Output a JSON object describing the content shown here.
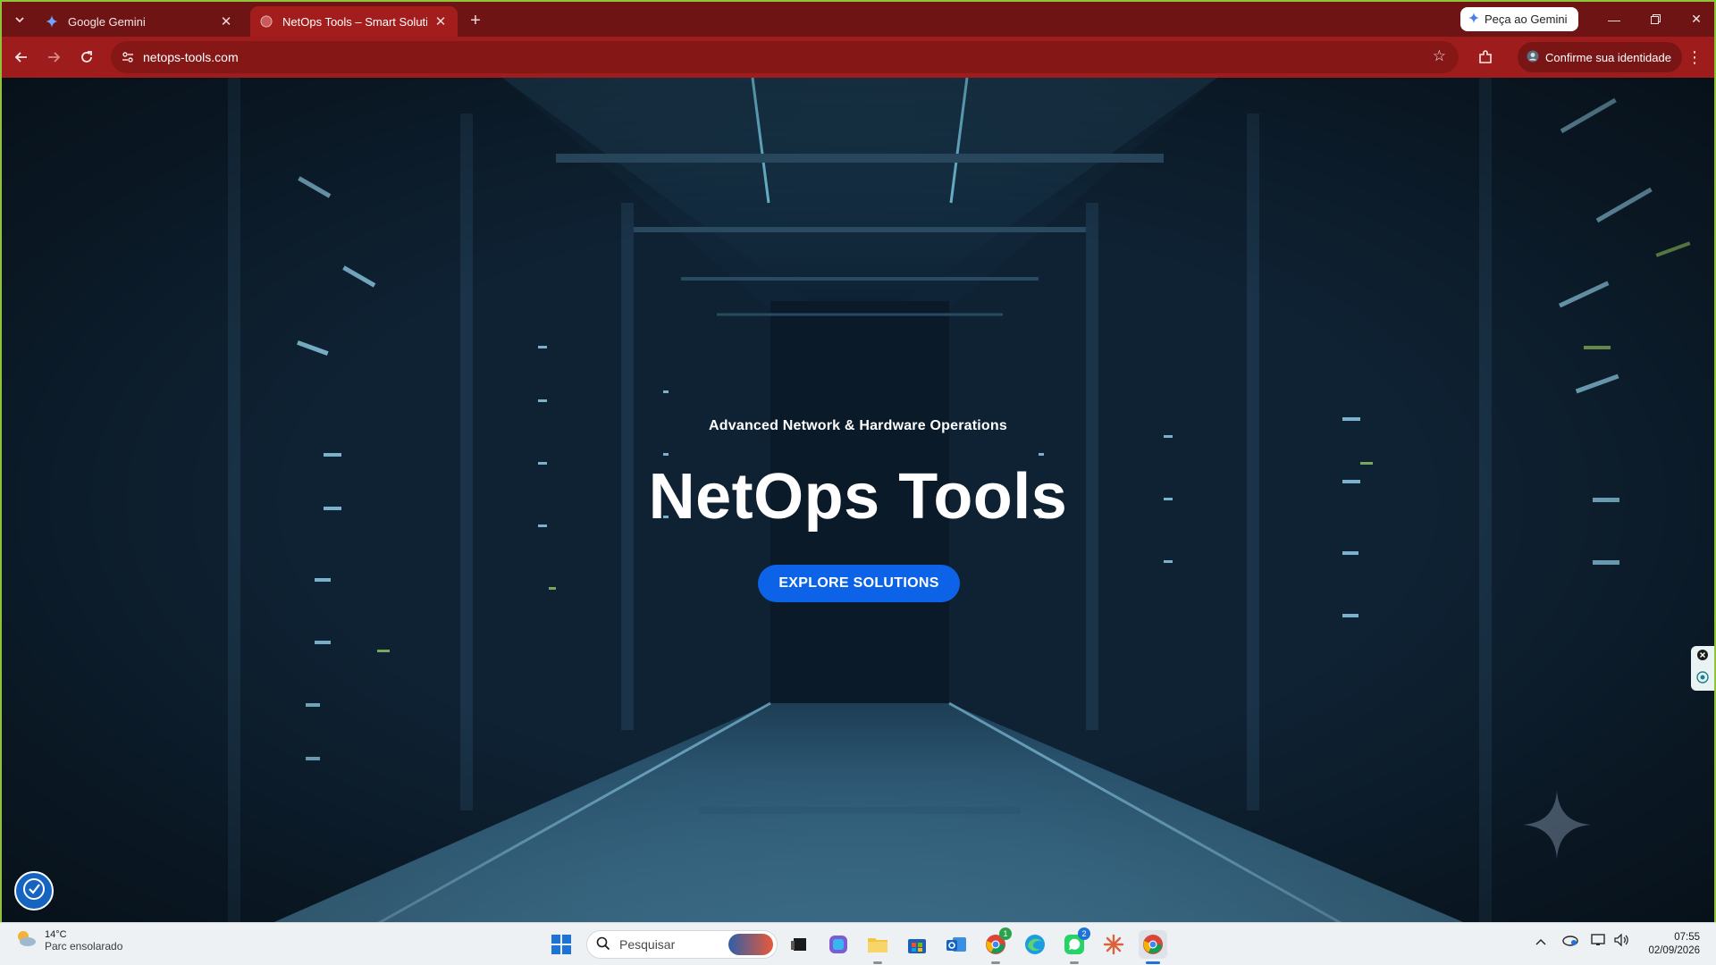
{
  "browser": {
    "tabs": [
      {
        "title": "Google Gemini",
        "active": false,
        "favicon": "gemini-icon"
      },
      {
        "title": "NetOps Tools – Smart Solutions",
        "active": true,
        "favicon": "globe-icon"
      }
    ],
    "gemini_button": "Peça ao Gemini",
    "url": "netops-tools.com",
    "profile_button": "Confirme sua identidade",
    "accent_color": "#9e1c1c"
  },
  "hero": {
    "subtitle": "Advanced Network & Hardware Operations",
    "title": "NetOps Tools",
    "cta_label": "EXPLORE SOLUTIONS",
    "cta_color": "#0d63e8"
  },
  "taskbar": {
    "weather": {
      "temp": "14°C",
      "condition": "Parc ensolarado"
    },
    "search_placeholder": "Pesquisar",
    "badges": {
      "chrome_profile": "1",
      "whatsapp": "2"
    },
    "clock": {
      "time": "07:55",
      "date": "02/09/2026"
    }
  }
}
